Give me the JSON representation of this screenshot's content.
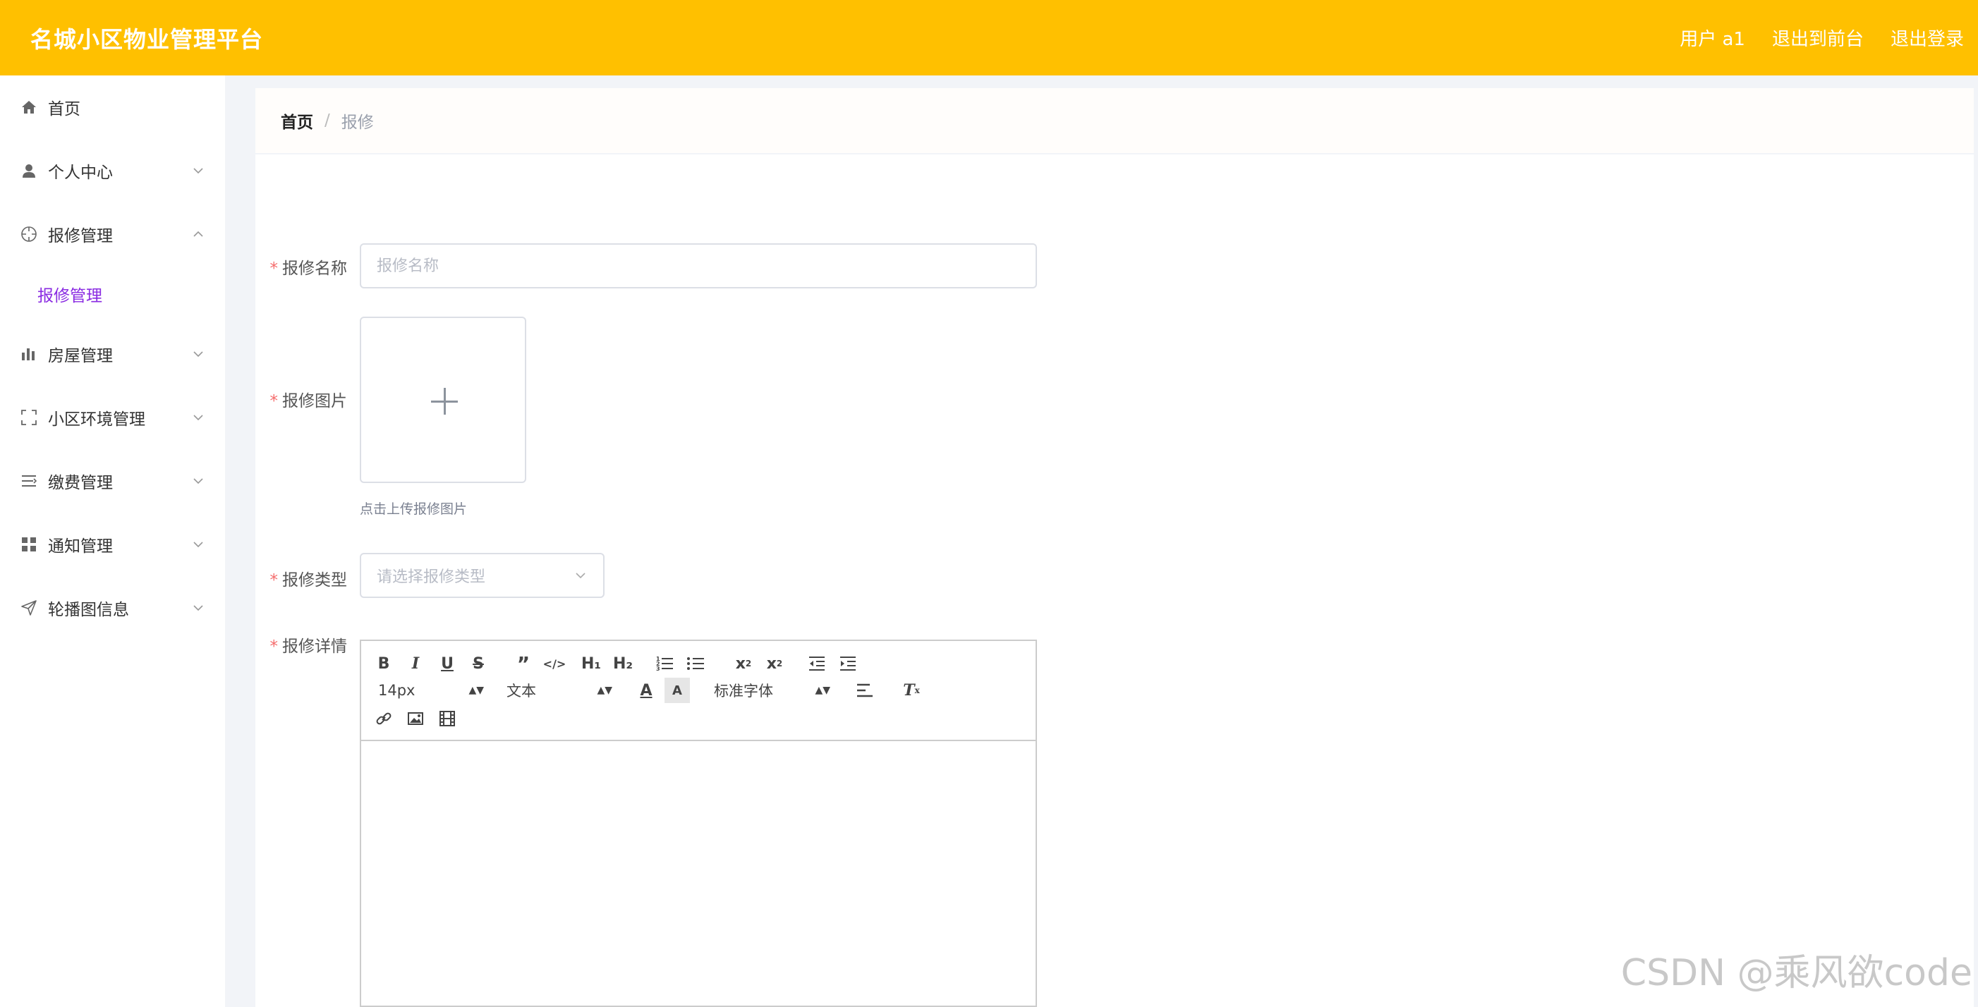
{
  "header": {
    "title": "名城小区物业管理平台",
    "user_label": "用户 a1",
    "to_front_label": "退出到前台",
    "logout_label": "退出登录"
  },
  "sidebar": {
    "items": [
      {
        "label": "首页",
        "icon": "home-icon",
        "has_children": false
      },
      {
        "label": "个人中心",
        "icon": "user-icon",
        "has_children": true,
        "expanded": false
      },
      {
        "label": "报修管理",
        "icon": "crosshair-icon",
        "has_children": true,
        "expanded": true
      },
      {
        "label": "房屋管理",
        "icon": "bar-chart-icon",
        "has_children": true,
        "expanded": false
      },
      {
        "label": "小区环境管理",
        "icon": "fullscreen-icon",
        "has_children": true,
        "expanded": false
      },
      {
        "label": "缴费管理",
        "icon": "list-icon",
        "has_children": true,
        "expanded": false
      },
      {
        "label": "通知管理",
        "icon": "grid-icon",
        "has_children": true,
        "expanded": false
      },
      {
        "label": "轮播图信息",
        "icon": "send-icon",
        "has_children": true,
        "expanded": false
      }
    ],
    "submenu": {
      "label": "报修管理"
    }
  },
  "breadcrumb": {
    "home": "首页",
    "separator": "/",
    "current": "报修"
  },
  "form": {
    "name": {
      "label": "报修名称",
      "placeholder": "报修名称",
      "value": ""
    },
    "image": {
      "label": "报修图片",
      "tip": "点击上传报修图片"
    },
    "type": {
      "label": "报修类型",
      "placeholder": "请选择报修类型"
    },
    "detail": {
      "label": "报修详情"
    },
    "required_mark": "*"
  },
  "editor": {
    "font_size": "14px",
    "header_select": "文本",
    "font_family": "标准字体",
    "h1": "H₁",
    "h2": "H₂"
  },
  "watermark": "CSDN @乘风欲code",
  "colors": {
    "header": "#ffc000",
    "submenu_active": "#8a2be2",
    "required": "#f56c6c"
  }
}
